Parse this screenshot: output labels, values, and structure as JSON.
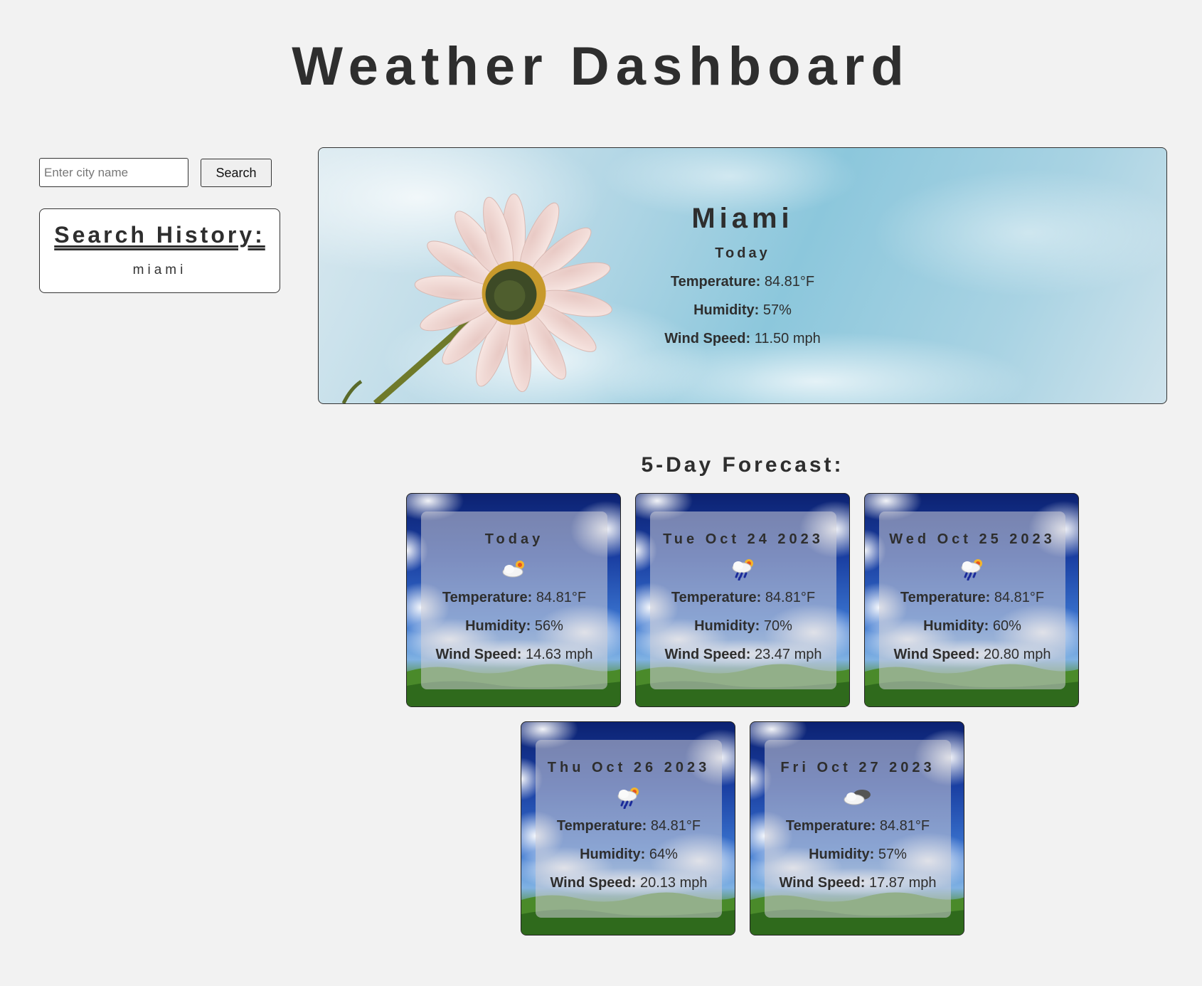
{
  "header": {
    "title": "Weather Dashboard"
  },
  "search": {
    "placeholder": "Enter city name",
    "value": "",
    "button_label": "Search"
  },
  "history": {
    "title": "Search History:",
    "items": [
      "miami"
    ]
  },
  "current": {
    "city": "Miami",
    "day": "Today",
    "temperature_label": "Temperature:",
    "temperature": "84.81°F",
    "humidity_label": "Humidity:",
    "humidity": "57%",
    "wind_label": "Wind Speed:",
    "wind": "11.50 mph"
  },
  "forecast": {
    "title": "5-Day Forecast:",
    "labels": {
      "temperature": "Temperature:",
      "humidity": "Humidity:",
      "wind": "Wind Speed:"
    },
    "days": [
      {
        "date": "Today",
        "icon": "partly-cloudy-icon",
        "temperature": "84.81°F",
        "humidity": "56%",
        "wind": "14.63 mph"
      },
      {
        "date": "Tue Oct 24 2023",
        "icon": "rain-sun-icon",
        "temperature": "84.81°F",
        "humidity": "70%",
        "wind": "23.47 mph"
      },
      {
        "date": "Wed Oct 25 2023",
        "icon": "rain-sun-icon",
        "temperature": "84.81°F",
        "humidity": "60%",
        "wind": "20.80 mph"
      },
      {
        "date": "Thu Oct 26 2023",
        "icon": "rain-sun-icon",
        "temperature": "84.81°F",
        "humidity": "64%",
        "wind": "20.13 mph"
      },
      {
        "date": "Fri Oct 27 2023",
        "icon": "broken-clouds-icon",
        "temperature": "84.81°F",
        "humidity": "57%",
        "wind": "17.87 mph"
      }
    ]
  }
}
